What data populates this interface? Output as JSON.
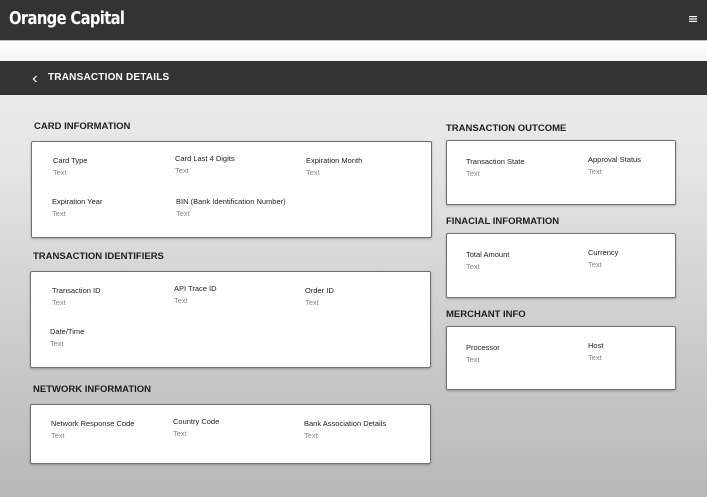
{
  "header": {
    "brand": "Orange Capital",
    "menu_icon": "hamburger-icon"
  },
  "page": {
    "back_icon": "chevron-left-icon",
    "title": "TRANSACTION DETAILS"
  },
  "sections": {
    "card_info": {
      "title": "CARD INFORMATION",
      "fields": [
        {
          "label": "Card Type",
          "value": "Text"
        },
        {
          "label": "Card Last 4 Digits",
          "value": "Text"
        },
        {
          "label": "Expiration Month",
          "value": "Text"
        },
        {
          "label": "Expiration Year",
          "value": "Text"
        },
        {
          "label": "BIN (Bank Identification Number)",
          "value": "Text"
        }
      ]
    },
    "identifiers": {
      "title": "TRANSACTION IDENTIFIERS",
      "fields": [
        {
          "label": "Transaction ID",
          "value": "Text"
        },
        {
          "label": "API Trace ID",
          "value": "Text"
        },
        {
          "label": "Order ID",
          "value": "Text"
        },
        {
          "label": "Date/Time",
          "value": "Text"
        }
      ]
    },
    "network": {
      "title": "NETWORK INFORMATION",
      "fields": [
        {
          "label": "Network Response Code",
          "value": "Text"
        },
        {
          "label": "Country Code",
          "value": "Text"
        },
        {
          "label": "Bank Association Details",
          "value": "Text"
        }
      ]
    },
    "outcome": {
      "title": "TRANSACTION OUTCOME",
      "fields": [
        {
          "label": "Transaction State",
          "value": "Text"
        },
        {
          "label": "Approval Status",
          "value": "Text"
        }
      ]
    },
    "financial": {
      "title": "FINACIAL INFORMATION",
      "fields": [
        {
          "label": "Total Amount",
          "value": "Text"
        },
        {
          "label": "Currency",
          "value": "Text"
        }
      ]
    },
    "merchant": {
      "title": "MERCHANT INFO",
      "fields": [
        {
          "label": "Processor",
          "value": "Text"
        },
        {
          "label": "Host",
          "value": "Text"
        }
      ]
    }
  }
}
